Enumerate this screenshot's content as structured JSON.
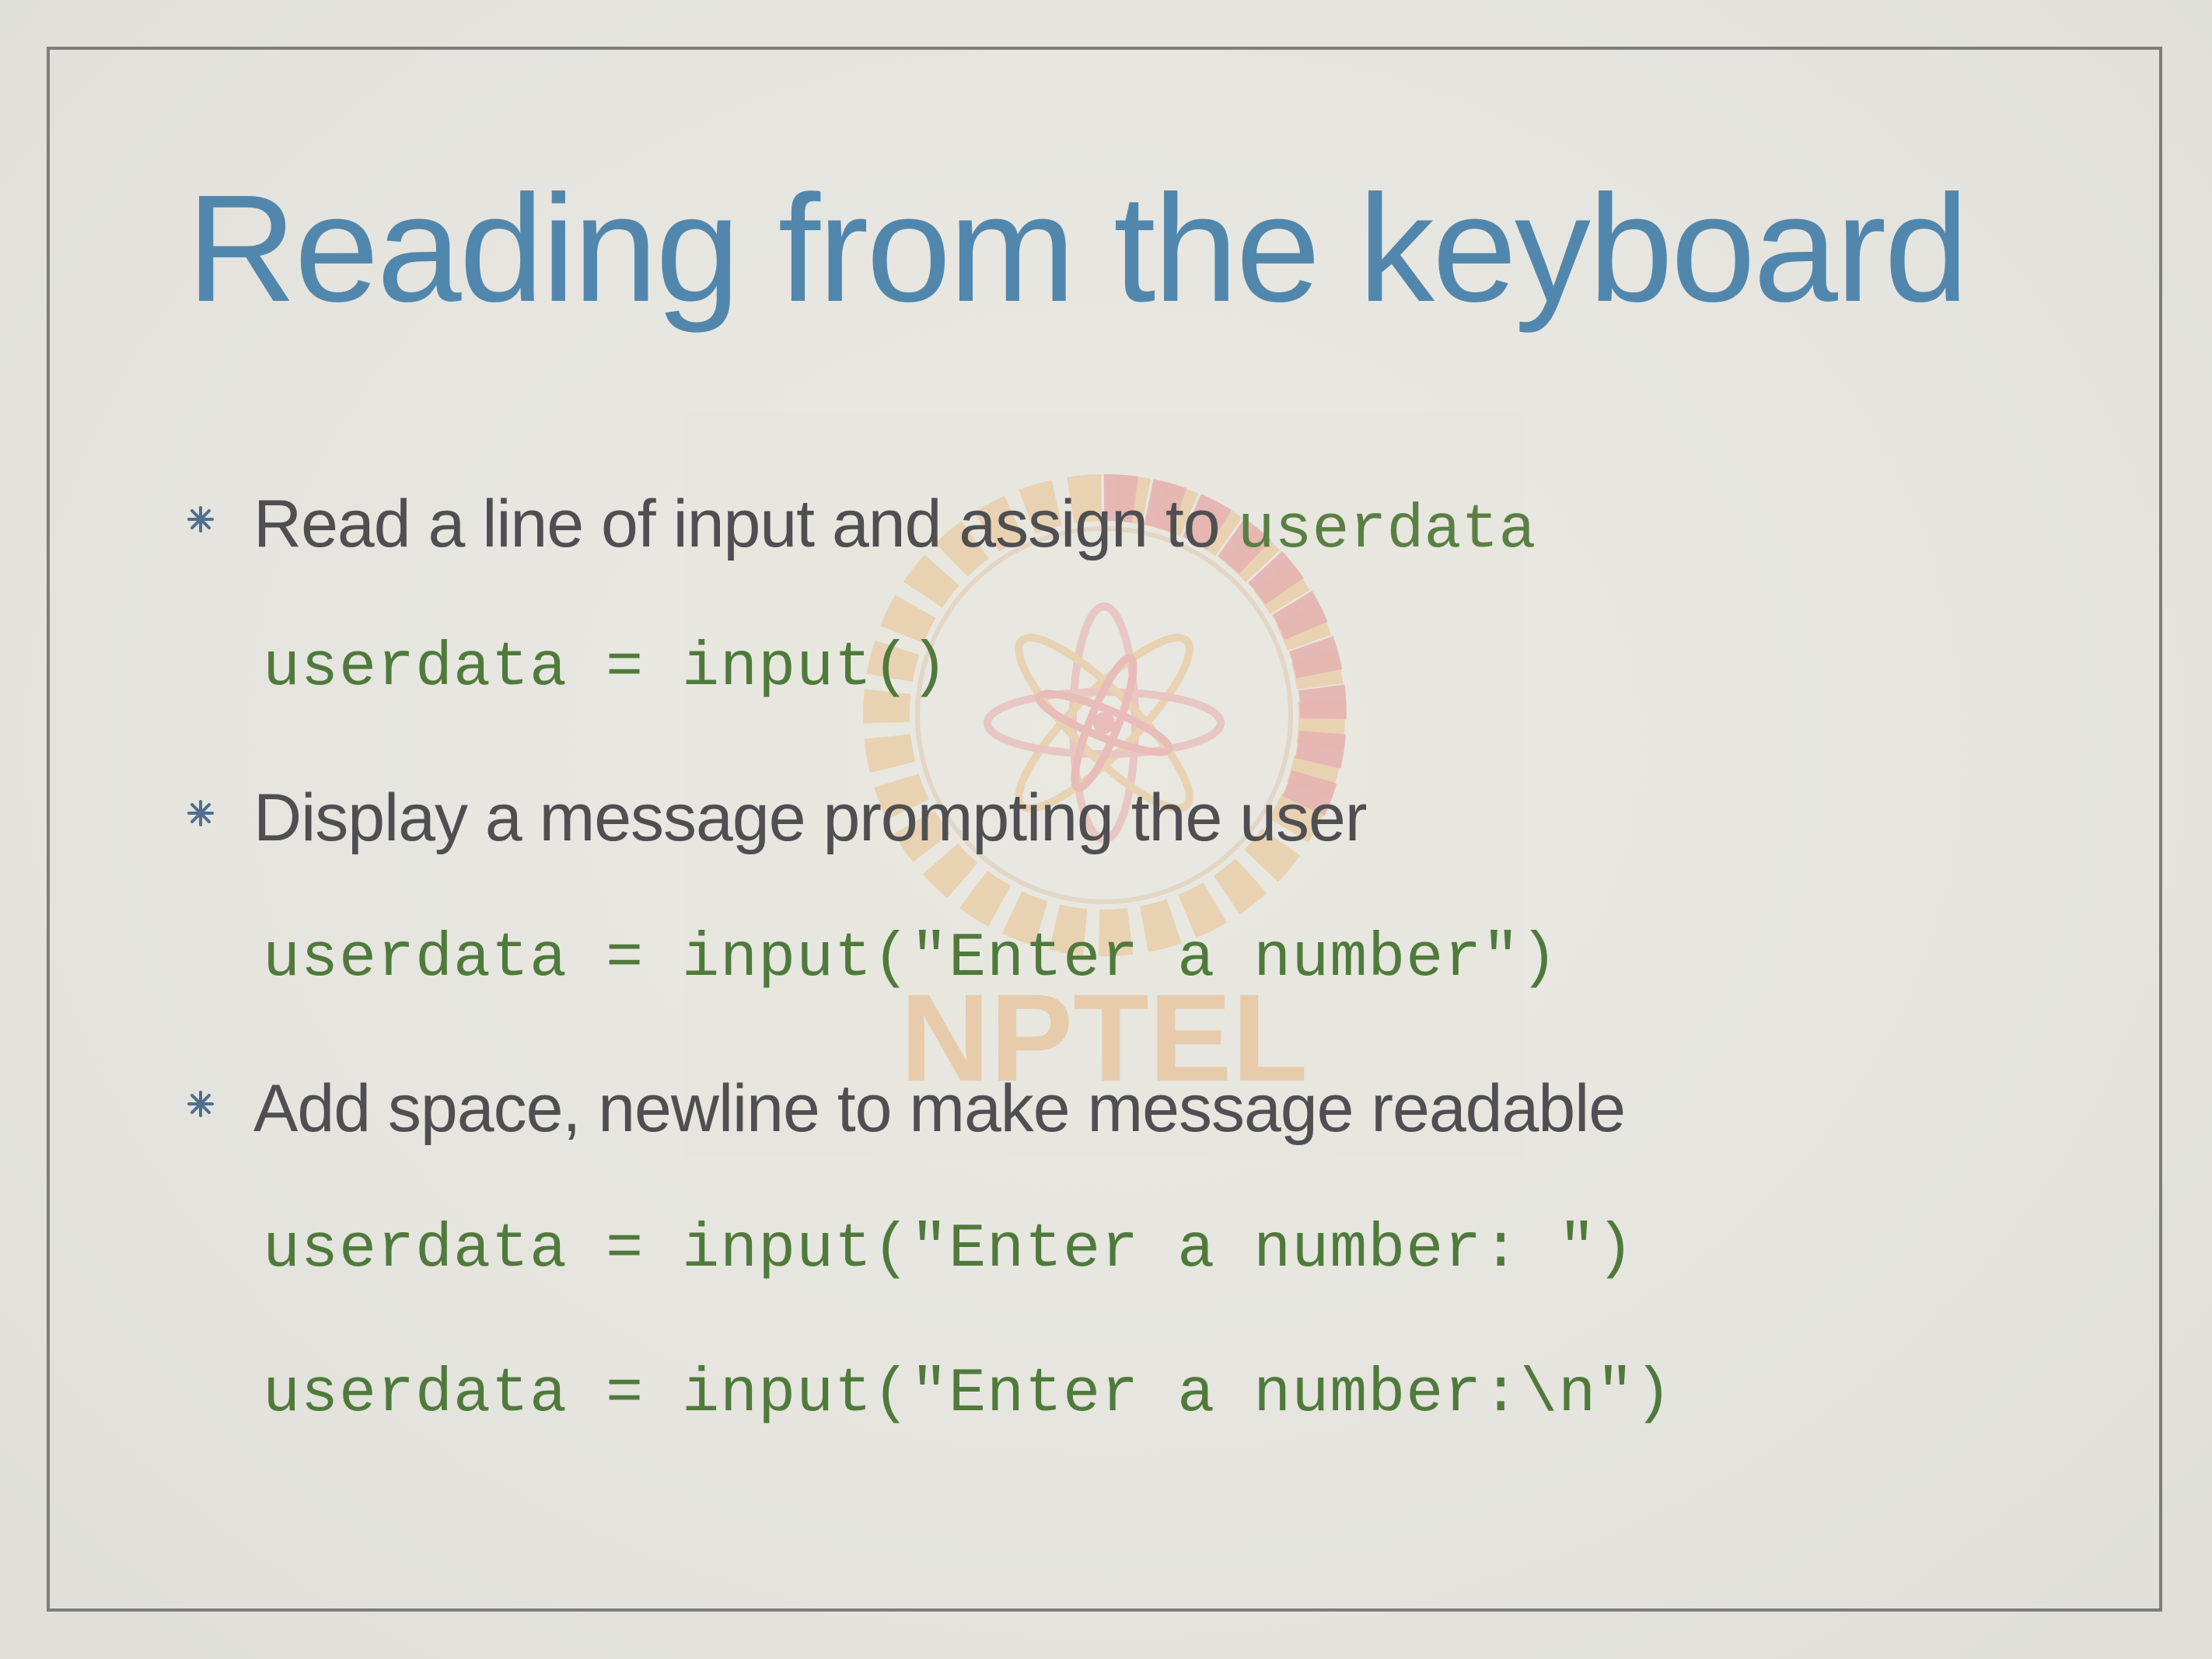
{
  "slide": {
    "title": "Reading from the keyboard",
    "watermark_text": "NPTEL",
    "bullets": [
      {
        "text": "Read a line of input and assign to ",
        "inline_code": "userdata",
        "code_lines": [
          "userdata = input()"
        ]
      },
      {
        "text": "Display a message prompting the user",
        "code_lines": [
          "userdata = input(\"Enter a number\")"
        ]
      },
      {
        "text": "Add space, newline to make message readable",
        "code_lines": [
          "userdata = input(\"Enter a number: \")",
          "userdata = input(\"Enter a number:\\n\")"
        ]
      }
    ]
  },
  "colors": {
    "background": "#e6e5df",
    "frame": "#7d7d7b",
    "title": "#5287ad",
    "body_text": "#4f4f52",
    "code": "#4f7a3b",
    "bullet_icon": "#4e6f8f"
  },
  "icons": {
    "bullet": "asterisk-bullet-icon",
    "watermark": "nptel-logo-icon"
  }
}
